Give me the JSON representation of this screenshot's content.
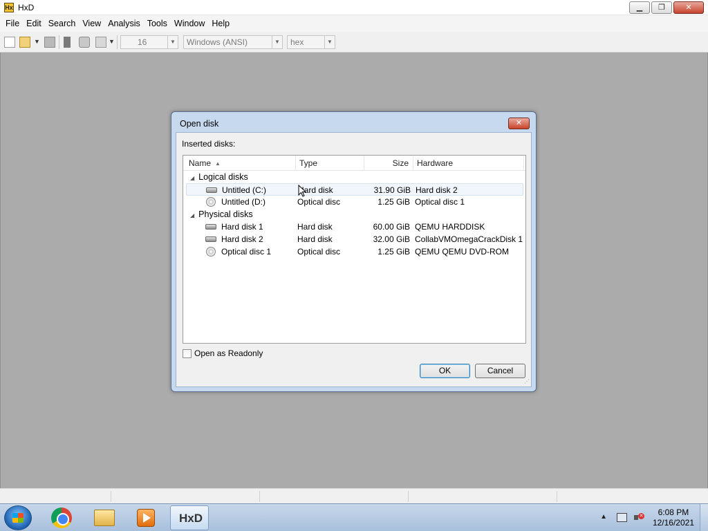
{
  "window": {
    "title": "HxD",
    "app_icon_text": "Hx",
    "minimize_glyph": "▁",
    "restore_glyph": "❐",
    "close_glyph": "✕"
  },
  "menu": [
    "File",
    "Edit",
    "Search",
    "View",
    "Analysis",
    "Tools",
    "Window",
    "Help"
  ],
  "toolbar": {
    "bytes_per_row": "16",
    "charset": "Windows (ANSI)",
    "offset_base": "hex",
    "dropdown_glyph": "▼"
  },
  "dialog": {
    "title": "Open disk",
    "close_glyph": "✕",
    "inserted_label": "Inserted disks:",
    "columns": {
      "name": "Name",
      "type": "Type",
      "size": "Size",
      "hardware": "Hardware",
      "sort_glyph": "▲"
    },
    "groups": [
      {
        "label": "Logical disks",
        "caret": "◢",
        "items": [
          {
            "name": "Untitled (C:)",
            "type": "Hard disk",
            "size": "31.90 GiB",
            "hardware": "Hard disk 2",
            "icon": "hard-disk-icon",
            "selected": true
          },
          {
            "name": "Untitled (D:)",
            "type": "Optical disc",
            "size": "1.25 GiB",
            "hardware": "Optical disc 1",
            "icon": "optical-disc-icon",
            "selected": false
          }
        ]
      },
      {
        "label": "Physical disks",
        "caret": "◢",
        "items": [
          {
            "name": "Hard disk 1",
            "type": "Hard disk",
            "size": "60.00 GiB",
            "hardware": "QEMU HARDDISK",
            "icon": "hard-disk-icon",
            "selected": false
          },
          {
            "name": "Hard disk 2",
            "type": "Hard disk",
            "size": "32.00 GiB",
            "hardware": "CollabVMOmegaCrackDisk 1",
            "icon": "hard-disk-icon",
            "selected": false
          },
          {
            "name": "Optical disc 1",
            "type": "Optical disc",
            "size": "1.25 GiB",
            "hardware": "QEMU QEMU DVD-ROM",
            "icon": "optical-disc-icon",
            "selected": false
          }
        ]
      }
    ],
    "readonly_label": "Open as Readonly",
    "readonly_checked": false,
    "ok_label": "OK",
    "cancel_label": "Cancel"
  },
  "taskbar": {
    "apps": [
      "chrome-icon",
      "folder-icon",
      "media-player-icon",
      "hxd-icon"
    ],
    "hxd_label": "HxD",
    "tray_arrow": "▲",
    "time": "6:08 PM",
    "date": "12/16/2021"
  }
}
